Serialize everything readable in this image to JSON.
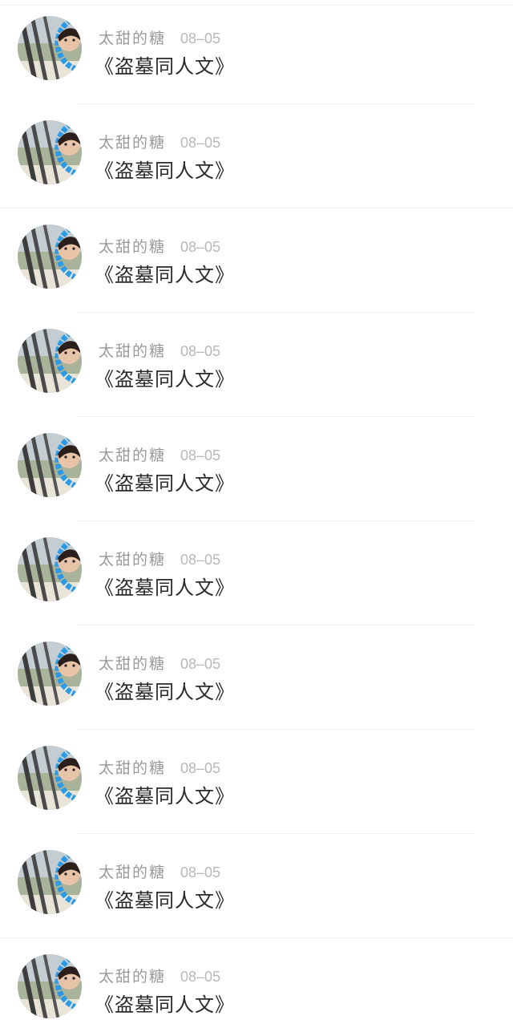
{
  "comments": [
    {
      "username": "太甜的糖",
      "date": "08–05",
      "text": "《盗墓同人文》"
    },
    {
      "username": "太甜的糖",
      "date": "08–05",
      "text": "《盗墓同人文》"
    },
    {
      "username": "太甜的糖",
      "date": "08–05",
      "text": "《盗墓同人文》"
    },
    {
      "username": "太甜的糖",
      "date": "08–05",
      "text": "《盗墓同人文》"
    },
    {
      "username": "太甜的糖",
      "date": "08–05",
      "text": "《盗墓同人文》"
    },
    {
      "username": "太甜的糖",
      "date": "08–05",
      "text": "《盗墓同人文》"
    },
    {
      "username": "太甜的糖",
      "date": "08–05",
      "text": "《盗墓同人文》"
    },
    {
      "username": "太甜的糖",
      "date": "08–05",
      "text": "《盗墓同人文》"
    },
    {
      "username": "太甜的糖",
      "date": "08–05",
      "text": "《盗墓同人文》"
    },
    {
      "username": "太甜的糖",
      "date": "08–05",
      "text": "《盗墓同人文》"
    }
  ],
  "avatar_icon": "user-avatar-photo",
  "colors": {
    "username": "#9a9a9a",
    "date": "#b8b8b8",
    "text": "#2a2a2a",
    "avatar_ring": "#2b9be8"
  }
}
